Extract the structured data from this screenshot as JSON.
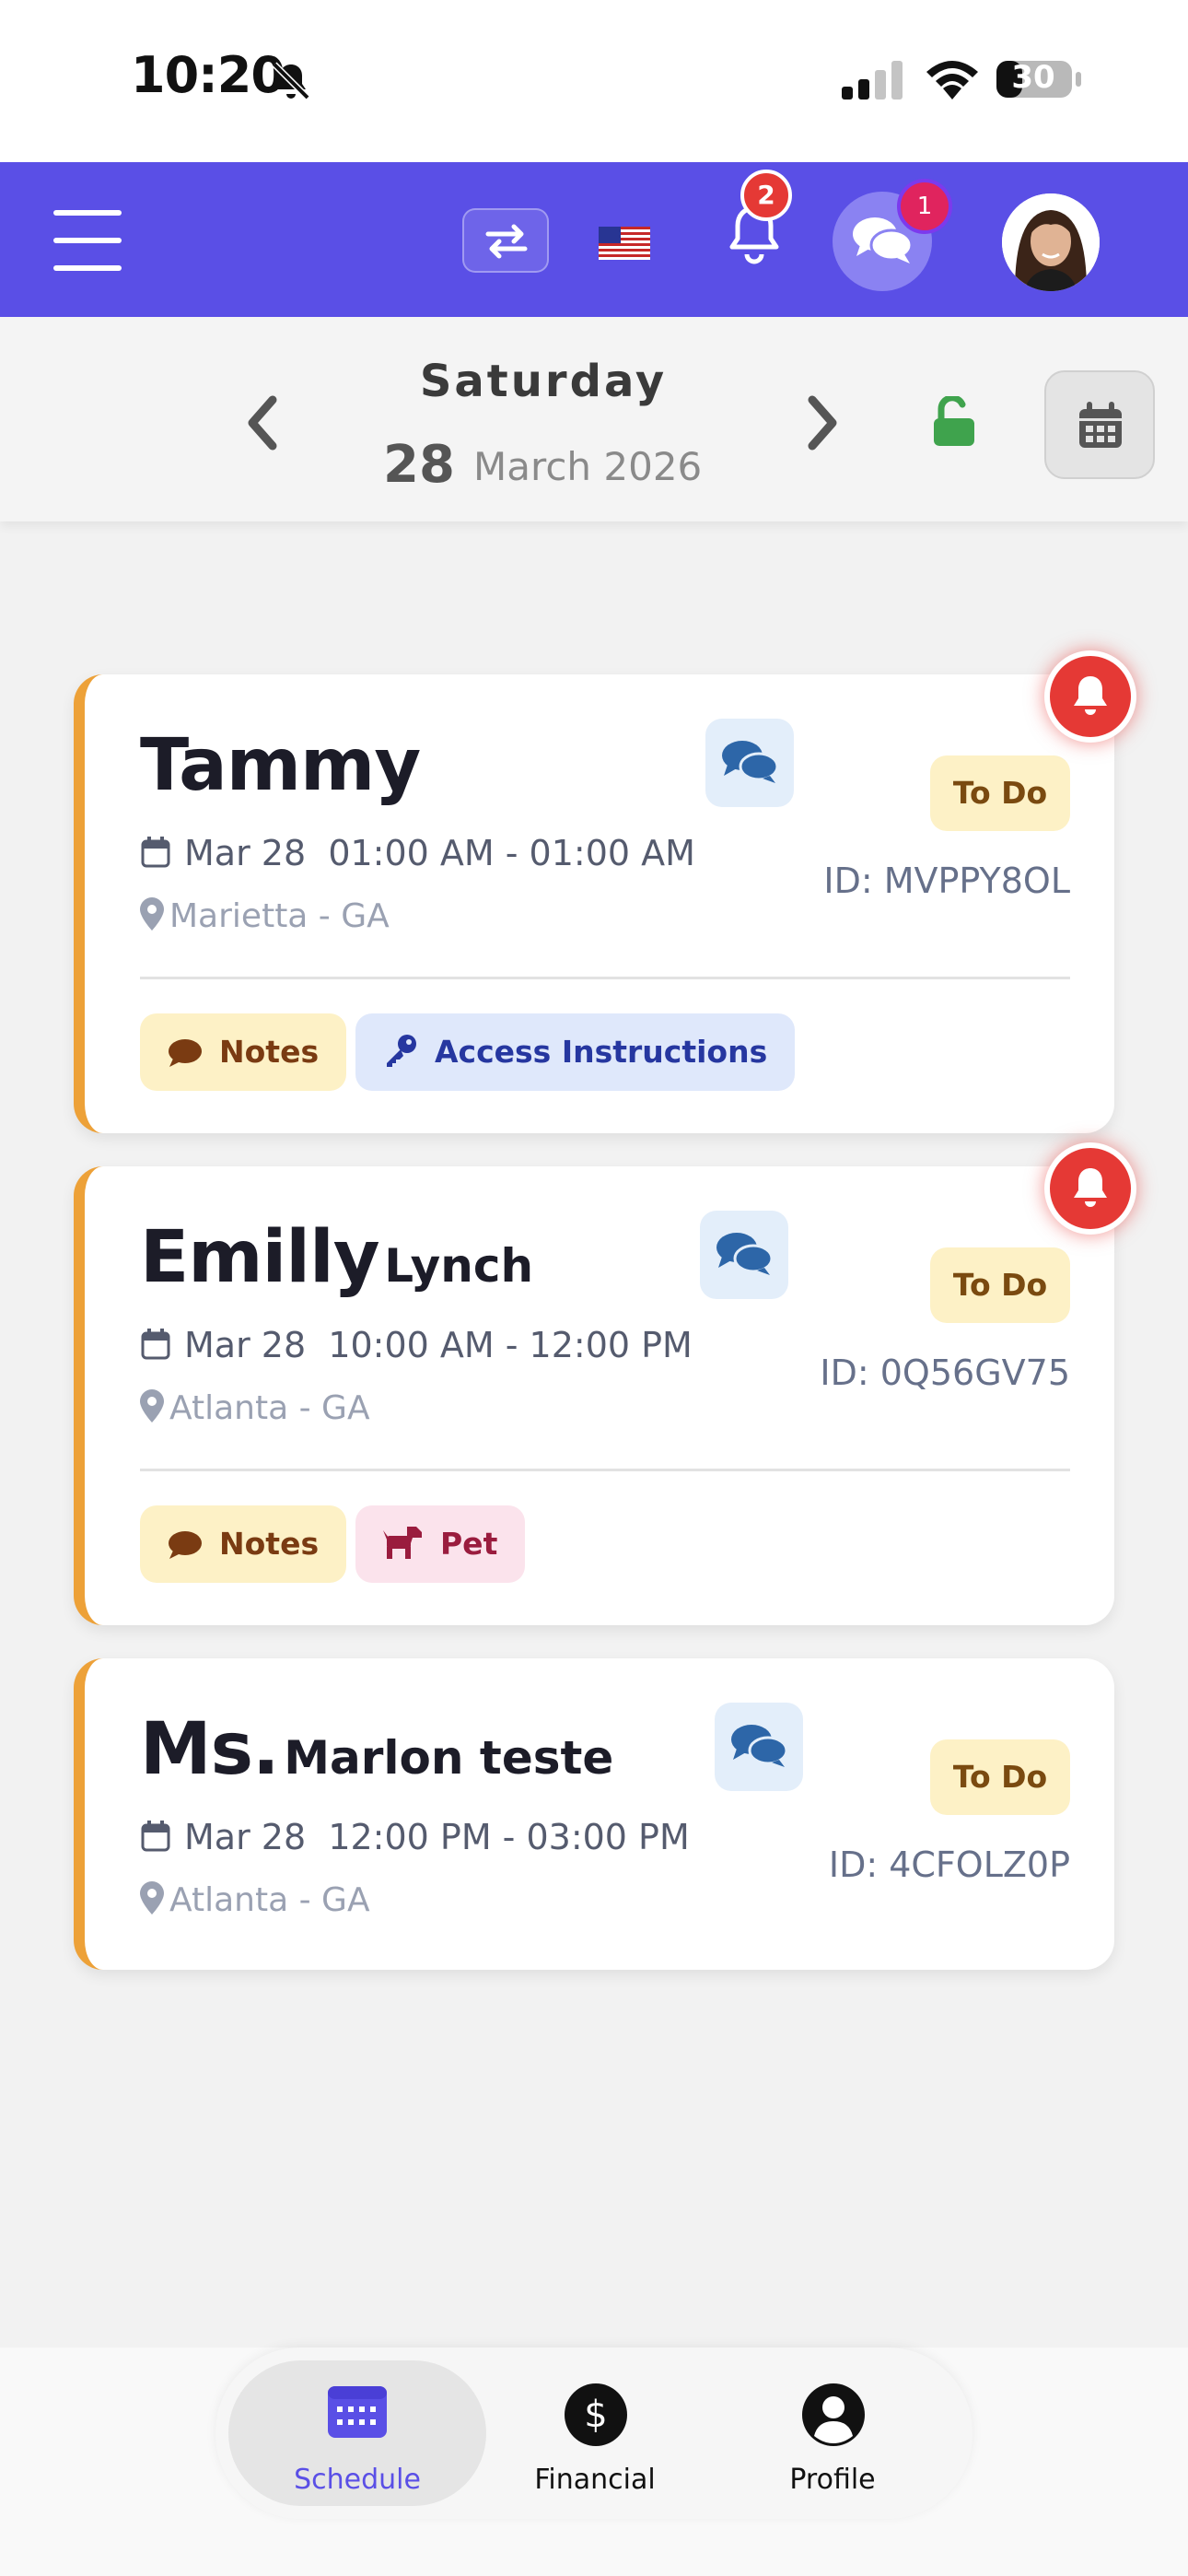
{
  "status_bar": {
    "time": "10:20",
    "battery": "30"
  },
  "header": {
    "notification_count": "2",
    "message_count": "1"
  },
  "date_bar": {
    "day_name": "Saturday",
    "day_number": "28",
    "month_year": "March 2026"
  },
  "appointments": [
    {
      "first": "Tammy",
      "last": "",
      "date": "Mar 28",
      "time": "01:00 AM - 01:00 AM",
      "location": "Marietta - GA",
      "status": "To Do",
      "id": "ID: MVPPY8OL",
      "chips": [
        "Notes",
        "Access Instructions"
      ]
    },
    {
      "first": "Emilly",
      "last": "Lynch",
      "date": "Mar 28",
      "time": "10:00 AM - 12:00 PM",
      "location": "Atlanta - GA",
      "status": "To Do",
      "id": "ID: 0Q56GV75",
      "chips": [
        "Notes",
        "Pet"
      ]
    },
    {
      "first": "Ms.",
      "last": "Marlon teste",
      "date": "Mar 28",
      "time": "12:00 PM - 03:00 PM",
      "location": "Atlanta - GA",
      "status": "To Do",
      "id": "ID: 4CFOLZ0P",
      "chips": []
    }
  ],
  "bottom_nav": {
    "schedule": "Schedule",
    "financial": "Financial",
    "profile": "Profile"
  },
  "icons": [
    "bell-slash-icon",
    "signal-icon",
    "wifi-icon",
    "battery-icon",
    "menu-icon",
    "swap-icon",
    "us-flag-icon",
    "bell-icon",
    "chat-icon",
    "avatar",
    "chevron-left-icon",
    "chevron-right-icon",
    "unlock-icon",
    "calendar-icon",
    "comment-icon",
    "key-icon",
    "dog-icon",
    "map-pin-icon",
    "dollar-icon",
    "user-icon"
  ],
  "colors": {
    "primary": "#5a4fe6",
    "card_accent": "#eda138",
    "alert": "#e53935",
    "unlock": "#3fa34d"
  }
}
